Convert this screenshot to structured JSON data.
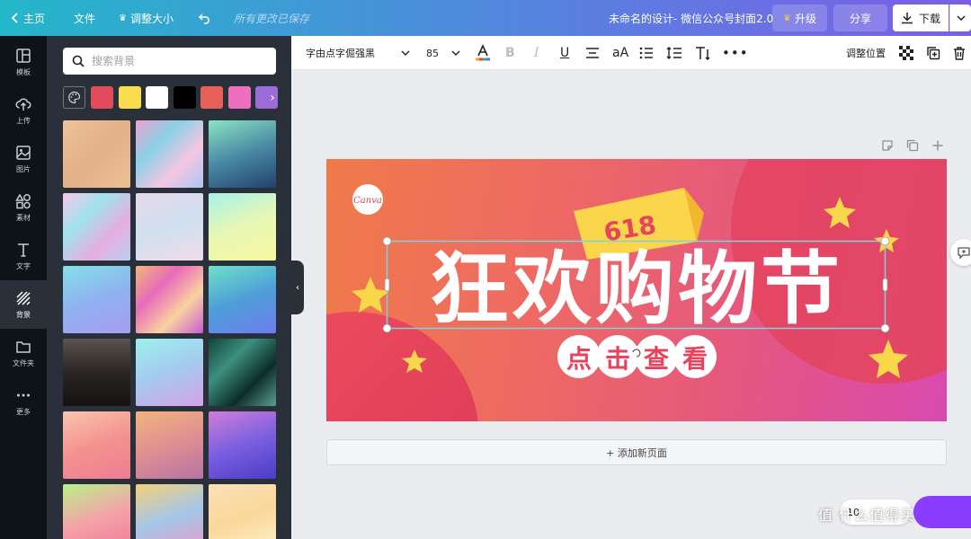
{
  "topbar": {
    "home": "主页",
    "file": "文件",
    "resize": "调整大小",
    "saved_status": "所有更改已保存",
    "doc_title": "未命名的设计- 微信公众号封面2.0",
    "upgrade": "升级",
    "share": "分享",
    "download": "下载"
  },
  "rail": [
    {
      "label": "模板",
      "icon": "template-icon"
    },
    {
      "label": "上传",
      "icon": "upload-icon"
    },
    {
      "label": "图片",
      "icon": "image-icon"
    },
    {
      "label": "素材",
      "icon": "elements-icon"
    },
    {
      "label": "文字",
      "icon": "text-icon"
    },
    {
      "label": "背景",
      "icon": "background-icon"
    },
    {
      "label": "文件夹",
      "icon": "folder-icon"
    },
    {
      "label": "更多",
      "icon": "more-icon"
    }
  ],
  "panel": {
    "search_placeholder": "搜索背景",
    "swatch_colors": [
      "#e24b5c",
      "#fadd4f",
      "#ffffff",
      "#000000",
      "#e8605a",
      "#ee6fc0",
      "#9b6bd8"
    ],
    "tiles": [
      "linear-gradient(135deg,#efc39a,#e3b08a,#eebf95)",
      "linear-gradient(135deg,#ee9fd1,#8ad1e6,#f5c6e3,#a8c9f2)",
      "linear-gradient(160deg,#8be3c5,#4a8aa4,#23406e)",
      "linear-gradient(135deg,#f7c8e8,#a0e2ed,#e6aedf,#b8d0f3)",
      "linear-gradient(160deg,#e7d8ec,#cfe0ef,#f3dbe9)",
      "linear-gradient(160deg,#a7f2ea,#e9f7b3,#f5f9a2)",
      "linear-gradient(160deg,#86dfe8,#8fb1f0,#a99cf0)",
      "linear-gradient(135deg,#f4b67a,#e76bb8,#f9d2a0,#c65bd3)",
      "linear-gradient(160deg,#6fe0c8,#4e9ed8,#6f7cf0)",
      "linear-gradient(180deg,#5b5350,#2b2624,#141110)",
      "linear-gradient(160deg,#9df0ec,#a6c9ef,#d4a3e8)",
      "linear-gradient(135deg,#10443c,#3d8f7e,#0d2c28,#5aa090)",
      "linear-gradient(160deg,#f9c4b0,#f3928e,#ee7d94)",
      "linear-gradient(160deg,#f1b57c,#df8f92,#b773a5)",
      "linear-gradient(160deg,#cf7fd8,#7b5fe0,#4a3cc7)",
      "linear-gradient(160deg,#b8f28a,#f4a3a8,#f07a9a)",
      "linear-gradient(160deg,#f5d07a,#a4c7e8,#e99aca)",
      "linear-gradient(160deg,#fbe0b6,#f9d89a,#fff1c9)"
    ]
  },
  "toolbar": {
    "font": "字由点字倔强黑",
    "size": "85",
    "case_btn": "aA",
    "position": "调整位置"
  },
  "canvas": {
    "logo": "Canva",
    "ribbon_text": "618",
    "headline": "狂欢购物节",
    "cta_chars": [
      "点",
      "击",
      "查",
      "看"
    ],
    "add_page": "+ 添加新页面"
  },
  "zoom": "10",
  "watermark": "值 什么值得买",
  "colors": {
    "accent": "#8b3dff",
    "rail_bg": "#0e1318",
    "panel_bg": "#293039",
    "star": "#f9d74a",
    "cta_text": "#e8435d"
  }
}
